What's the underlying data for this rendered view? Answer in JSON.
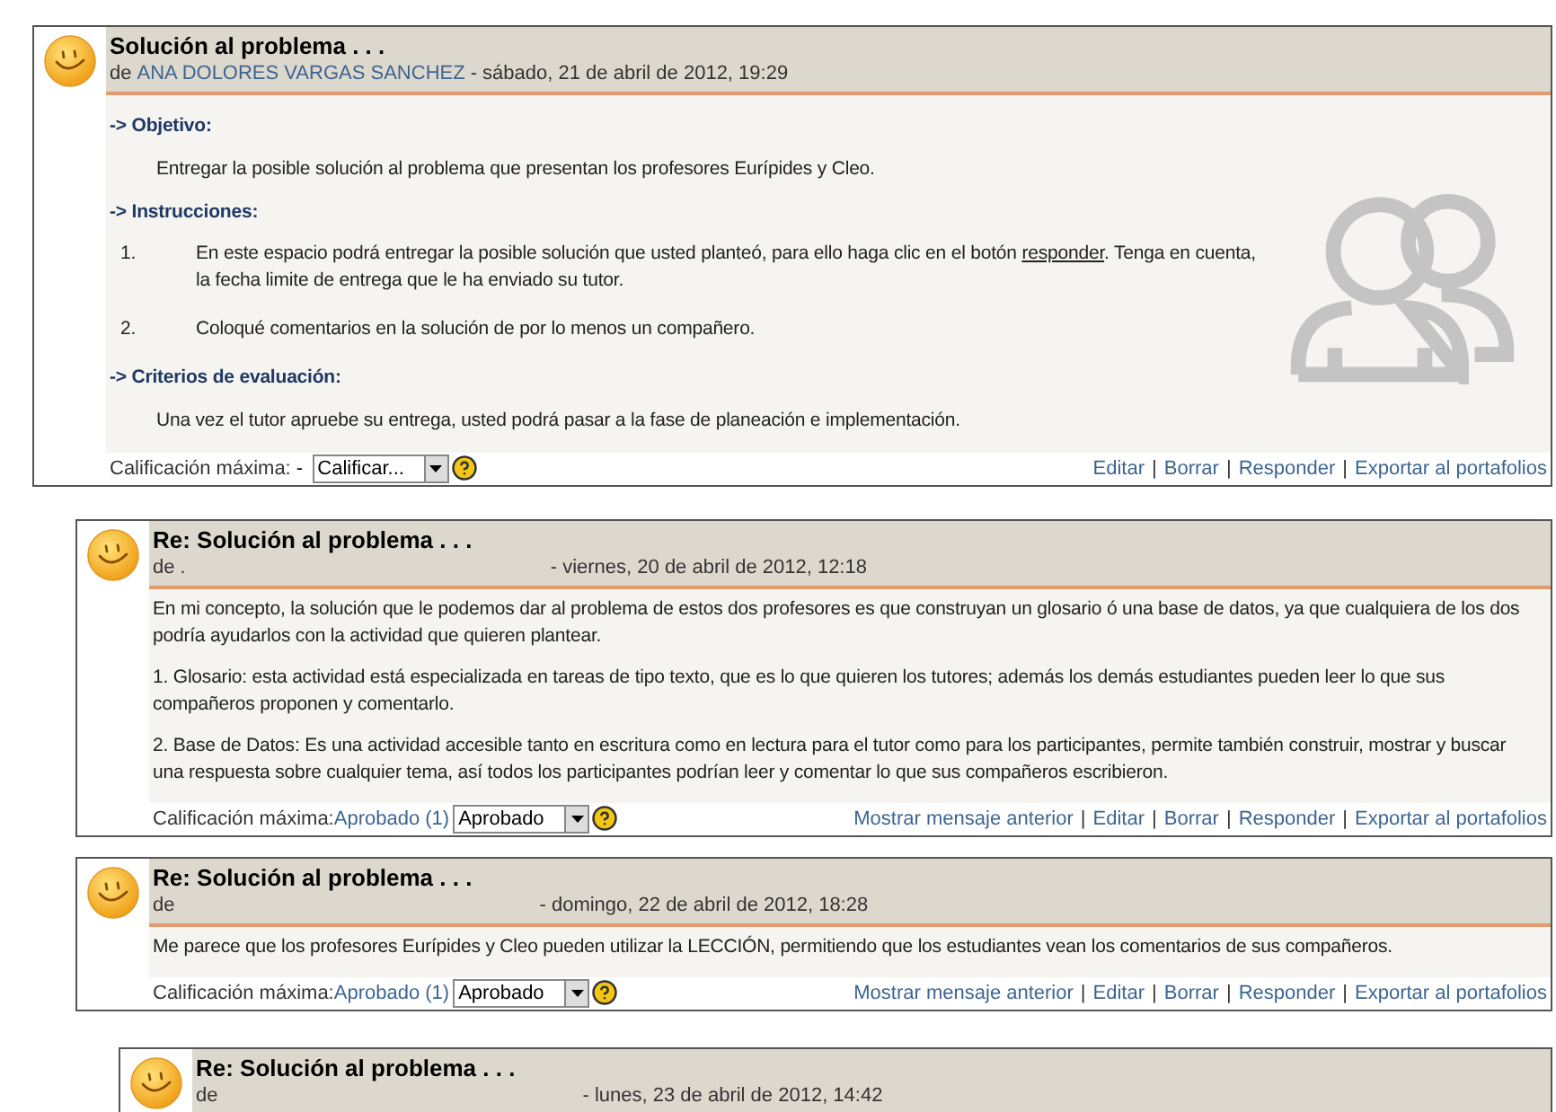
{
  "posts": [
    {
      "title": "Solución al problema . . .",
      "author_prefix": "de",
      "author": "ANA DOLORES VARGAS SANCHEZ",
      "date": "- sábado, 21 de abril de 2012, 19:29",
      "show_people_drawing": true,
      "body": [
        {
          "kind": "heading",
          "text": "-> Objetivo:"
        },
        {
          "kind": "indented",
          "text": "Entregar la posible solución al problema que presentan los profesores Eurípides y Cleo."
        },
        {
          "kind": "heading",
          "text": "-> Instrucciones:"
        },
        {
          "kind": "numbered",
          "number": "1.",
          "text": "En este espacio podrá entregar la posible solución que usted planteó, para ello haga clic en el botón",
          "link": "responder",
          "text_after": ". Tenga en cuenta, la fecha limite de entrega que le ha enviado su tutor."
        },
        {
          "kind": "numbered",
          "number": "2.",
          "text": "Coloqué comentarios en la solución de por lo menos un compañero."
        },
        {
          "kind": "heading",
          "text": "-> Criterios de evaluación:"
        },
        {
          "kind": "indented",
          "text": "Una vez el tutor apruebe su entrega, usted podrá pasar a la fase de planeación e implementación."
        }
      ],
      "rating": {
        "label": "Calificación máxima:",
        "kind": "text",
        "value": " - ",
        "select": "Calificar..."
      },
      "links": [
        "Editar",
        "Borrar",
        "Responder",
        "Exportar al portafolios"
      ],
      "link_separator": "|",
      "children": [
        {
          "title": "Re: Solución al problema . . .",
          "author_prefix": "de .",
          "date": "- viernes, 20 de abril de 2012, 12:18",
          "body": [
            {
              "kind": "paragraph",
              "text": "En mi concepto, la solución que le podemos dar al problema de estos dos profesores es que construyan un glosario ó una base de datos, ya que cualquiera de los dos podría ayudarlos con la actividad que quieren plantear."
            },
            {
              "kind": "paragraph",
              "text": "1. Glosario:  esta actividad está especializada en tareas de tipo texto, que es lo que quieren los tutores; además los demás estudiantes pueden leer lo que sus compañeros proponen y comentarlo."
            },
            {
              "kind": "paragraph",
              "text": "2. Base de Datos: Es una actividad accesible tanto en escritura como en lectura para el tutor como para los participantes, permite también construir, mostrar y buscar una respuesta sobre cualquier tema, así todos los participantes podrían leer y comentar lo que sus compañeros escribieron."
            }
          ],
          "rating": {
            "label": "Calificación máxima:",
            "kind": "link",
            "value": "Aprobado (1)",
            "select": "Aprobado"
          },
          "links": [
            "Mostrar mensaje anterior",
            "Editar",
            "Borrar",
            "Responder",
            "Exportar al portafolios"
          ],
          "link_separator": "|"
        },
        {
          "title": "Re: Solución al problema . . .",
          "author_prefix": "de",
          "date": "- domingo, 22 de abril de 2012, 18:28",
          "body": [
            {
              "kind": "paragraph",
              "text": "Me parece que los profesores Eurípides y Cleo pueden utilizar la LECCIÓN, permitiendo que los estudiantes vean los comentarios de sus compañeros."
            }
          ],
          "rating": {
            "label": "Calificación máxima:",
            "kind": "link",
            "value": "Aprobado (1)",
            "select": "Aprobado"
          },
          "links": [
            "Mostrar mensaje anterior",
            "Editar",
            "Borrar",
            "Responder",
            "Exportar al portafolios"
          ],
          "link_separator": "|",
          "children": [
            {
              "title": "Re: Solución al problema . . .",
              "author_prefix": "de",
              "date": "- lunes, 23 de abril de 2012, 14:42"
            }
          ]
        }
      ]
    }
  ]
}
